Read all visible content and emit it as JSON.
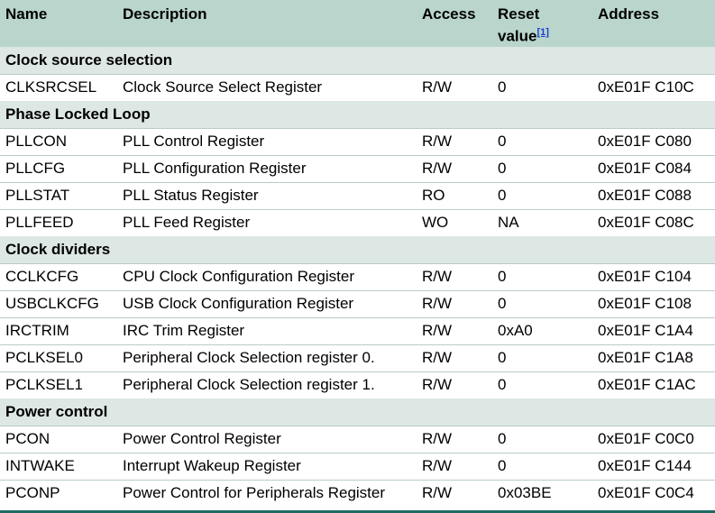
{
  "header": {
    "name": "Name",
    "description": "Description",
    "access": "Access",
    "reset_line1": "Reset",
    "reset_line2": "value",
    "reset_note": "[1]",
    "address": "Address"
  },
  "sections": [
    {
      "title": "Clock source selection",
      "rows": [
        [
          "CLKSRCSEL",
          "Clock Source Select Register",
          "R/W",
          "0",
          "0xE01F C10C"
        ]
      ]
    },
    {
      "title": "Phase Locked Loop",
      "rows": [
        [
          "PLLCON",
          "PLL Control Register",
          "R/W",
          "0",
          "0xE01F C080"
        ],
        [
          "PLLCFG",
          "PLL Configuration Register",
          "R/W",
          "0",
          "0xE01F C084"
        ],
        [
          "PLLSTAT",
          "PLL Status Register",
          "RO",
          "0",
          "0xE01F C088"
        ],
        [
          "PLLFEED",
          "PLL Feed Register",
          "WO",
          "NA",
          "0xE01F C08C"
        ]
      ]
    },
    {
      "title": "Clock dividers",
      "rows": [
        [
          "CCLKCFG",
          "CPU Clock Configuration Register",
          "R/W",
          "0",
          "0xE01F C104"
        ],
        [
          "USBCLKCFG",
          "USB Clock Configuration Register",
          "R/W",
          "0",
          "0xE01F C108"
        ],
        [
          "IRCTRIM",
          "IRC Trim Register",
          "R/W",
          "0xA0",
          "0xE01F C1A4"
        ],
        [
          "PCLKSEL0",
          "Peripheral Clock Selection register 0.",
          "R/W",
          "0",
          "0xE01F C1A8"
        ],
        [
          "PCLKSEL1",
          "Peripheral Clock Selection register 1.",
          "R/W",
          "0",
          "0xE01F C1AC"
        ]
      ]
    },
    {
      "title": "Power control",
      "rows": [
        [
          "PCON",
          "Power Control Register",
          "R/W",
          "0",
          "0xE01F C0C0"
        ],
        [
          "INTWAKE",
          "Interrupt Wakeup Register",
          "R/W",
          "0",
          "0xE01F C144"
        ],
        [
          "PCONP",
          "Power Control for Peripherals Register",
          "R/W",
          "0x03BE",
          "0xE01F C0C4"
        ]
      ]
    }
  ]
}
